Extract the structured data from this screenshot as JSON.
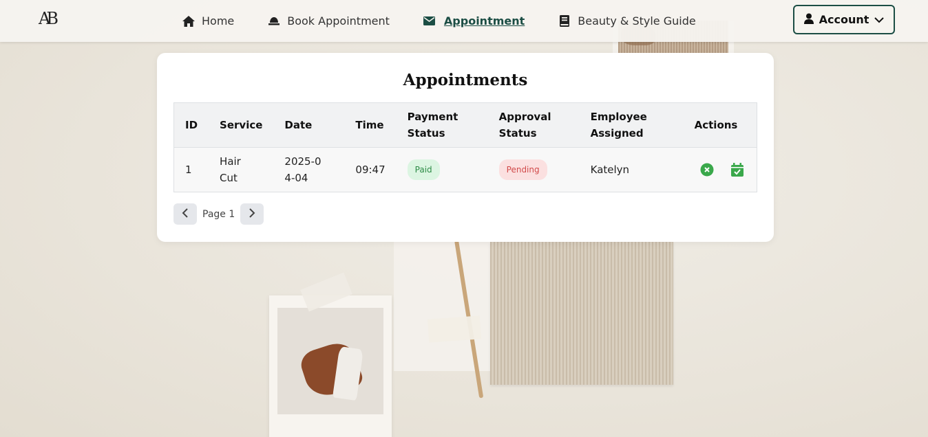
{
  "brand": {
    "logo_text": "AB"
  },
  "nav": {
    "items": [
      {
        "label": "Home",
        "icon": "home-icon"
      },
      {
        "label": "Book Appointment",
        "icon": "bell-icon"
      },
      {
        "label": "Appointment",
        "icon": "envelope-icon",
        "active": true
      },
      {
        "label": "Beauty & Style Guide",
        "icon": "book-icon"
      }
    ],
    "account_label": "Account"
  },
  "colors": {
    "accent": "#1b4d44",
    "paid": "#2e8b47",
    "pending": "#d14a4a",
    "action_green": "#3aa84b"
  },
  "appointments": {
    "title": "Appointments",
    "columns": [
      "ID",
      "Service",
      "Date",
      "Time",
      "Payment Status",
      "Approval Status",
      "Employee Assigned",
      "Actions"
    ],
    "rows": [
      {
        "id": "1",
        "service": "Hair Cut",
        "date": "2025-04-04",
        "time": "09:47",
        "payment": "Paid",
        "approval": "Pending",
        "employee": "Katelyn"
      }
    ],
    "pagination": {
      "label": "Page 1"
    }
  }
}
